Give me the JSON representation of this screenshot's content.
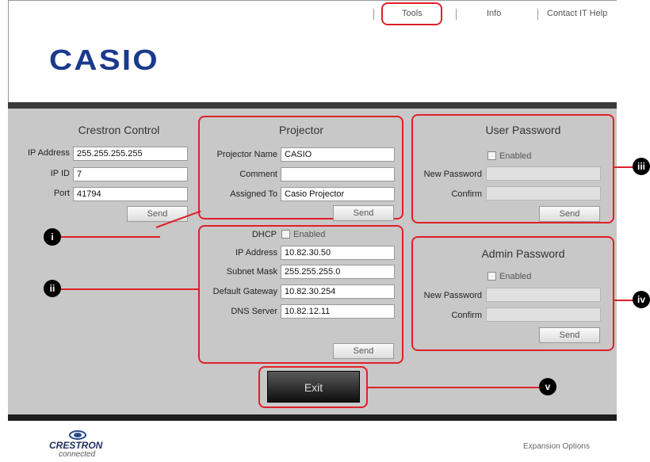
{
  "nav": {
    "tools": "Tools",
    "info": "Info",
    "contact": "Contact IT Help"
  },
  "logo": "CASIO",
  "crestron_control": {
    "title": "Crestron Control",
    "ip_label": "IP Address",
    "ip_value": "255.255.255.255",
    "ipid_label": "IP ID",
    "ipid_value": "7",
    "port_label": "Port",
    "port_value": "41794",
    "send": "Send"
  },
  "projector": {
    "title": "Projector",
    "name_label": "Projector Name",
    "name_value": "CASIO",
    "comment_label": "Comment",
    "comment_value": "",
    "assigned_label": "Assigned To",
    "assigned_value": "Casio Projector",
    "send": "Send"
  },
  "network": {
    "dhcp_label": "DHCP",
    "dhcp_enabled": "Enabled",
    "ip_label": "IP Address",
    "ip_value": "10.82.30.50",
    "subnet_label": "Subnet Mask",
    "subnet_value": "255.255.255.0",
    "gateway_label": "Default Gateway",
    "gateway_value": "10.82.30.254",
    "dns_label": "DNS Server",
    "dns_value": "10.82.12.11",
    "send": "Send"
  },
  "user_password": {
    "title": "User Password",
    "enabled": "Enabled",
    "new_label": "New Password",
    "confirm_label": "Confirm",
    "send": "Send"
  },
  "admin_password": {
    "title": "Admin Password",
    "enabled": "Enabled",
    "new_label": "New Password",
    "confirm_label": "Confirm",
    "send": "Send"
  },
  "exit": "Exit",
  "markers": {
    "i": "i",
    "ii": "ii",
    "iii": "iii",
    "iv": "iv",
    "v": "v"
  },
  "footer": {
    "crestron": "CRESTRON",
    "connected": "connected",
    "expansion": "Expansion Options"
  },
  "colors": {
    "highlight": "#e0202a",
    "logo": "#1a3a8c",
    "panel": "#c8c8c8"
  }
}
